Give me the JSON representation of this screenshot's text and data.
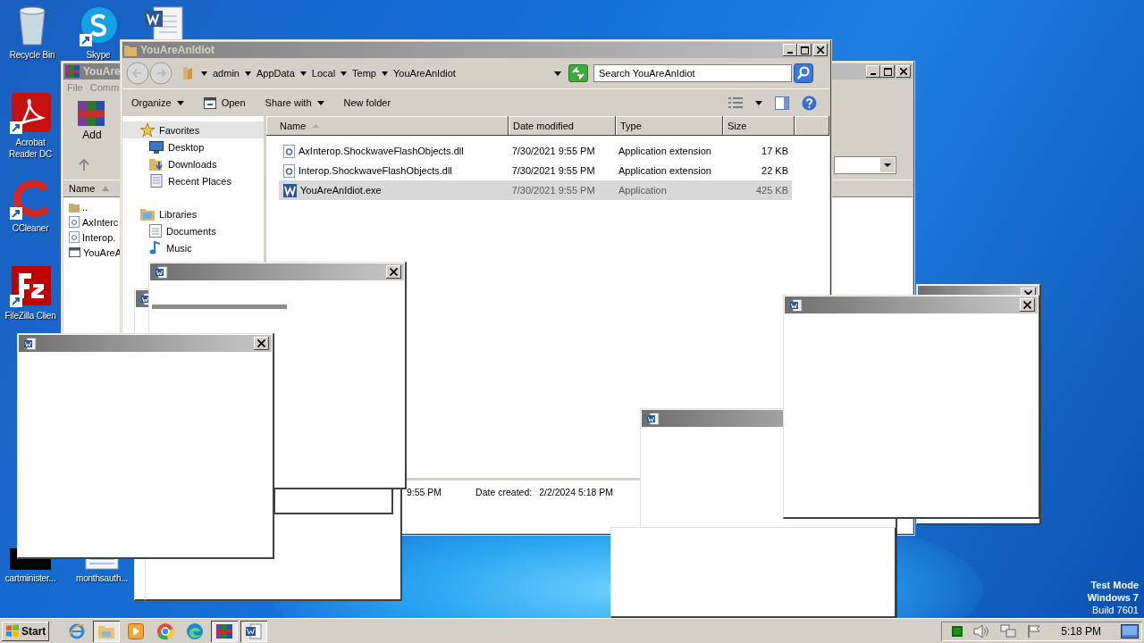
{
  "desktop_icons": [
    {
      "label": "Recycle Bin",
      "kind": "recycle"
    },
    {
      "label": "Skype",
      "kind": "skype"
    },
    {
      "kind": "word"
    },
    {
      "label": "Acrobat Reader DC",
      "kind": "acrobat"
    },
    {
      "label": "CCleaner",
      "kind": "ccleaner"
    },
    {
      "label": "FileZilla Clien",
      "kind": "filezilla"
    },
    {
      "label": "cartminister...",
      "kind": "black"
    },
    {
      "label": "monthsauth...",
      "kind": "document"
    }
  ],
  "winrar": {
    "title": "YouAre",
    "menu": [
      "File",
      "Comm"
    ],
    "add": "Add",
    "column": "Name",
    "files": [
      {
        "name": "..",
        "kind": "folder"
      },
      {
        "name": "AxInterc",
        "kind": "dll"
      },
      {
        "name": "Interop.",
        "kind": "dll"
      },
      {
        "name": "YouAreA",
        "kind": "exe"
      }
    ]
  },
  "explorer": {
    "title": "YouAreAnIdiot",
    "breadcrumb": [
      "admin",
      "AppData",
      "Local",
      "Temp",
      "YouAreAnIdiot"
    ],
    "search": {
      "placeholder": "Search YouAreAnIdiot"
    },
    "toolbar": [
      {
        "label": "Organize",
        "kind": "menu"
      },
      {
        "label": "Open",
        "kind": "open"
      },
      {
        "label": "Share with",
        "kind": "menu"
      },
      {
        "label": "New folder",
        "kind": "plain"
      }
    ],
    "nav": [
      {
        "label": "Favorites",
        "kind": "star",
        "selected": true,
        "children": [
          {
            "label": "Desktop",
            "kind": "desktop",
            "selected": false
          },
          {
            "label": "Downloads",
            "kind": "downloads",
            "selected": false
          },
          {
            "label": "Recent Places",
            "kind": "recent",
            "selected": false
          }
        ]
      },
      {
        "label": "Libraries",
        "kind": "library",
        "selected": false,
        "children": [
          {
            "label": "Documents",
            "kind": "documents",
            "selected": false
          },
          {
            "label": "Music",
            "kind": "music",
            "selected": false
          }
        ]
      }
    ],
    "columns": [
      "Name",
      "Date modified",
      "Type",
      "Size"
    ],
    "rows": [
      {
        "name": "AxInterop.ShockwaveFlashObjects.dll",
        "date": "7/30/2021 9:55 PM",
        "type": "Application extension",
        "size": "17 KB",
        "kind": "dll",
        "selected": false
      },
      {
        "name": "Interop.ShockwaveFlashObjects.dll",
        "date": "7/30/2021 9:55 PM",
        "type": "Application extension",
        "size": "22 KB",
        "kind": "dll",
        "selected": false
      },
      {
        "name": "YouAreAnIdiot.exe",
        "date": "7/30/2021 9:55 PM",
        "type": "Application",
        "size": "425 KB",
        "kind": "exe",
        "selected": true
      }
    ],
    "details": {
      "modified": "9:55 PM",
      "created_label": "Date created:",
      "created": "2/2/2024 5:18 PM"
    }
  },
  "popups": [
    {
      "kind": "plain"
    },
    {
      "kind": "plain"
    },
    {
      "kind": "plain"
    },
    {
      "kind": "plain"
    },
    {
      "kind": "frame"
    },
    {
      "kind": "frame"
    },
    {
      "kind": "progress",
      "level": 0.54
    },
    {
      "kind": "plain"
    }
  ],
  "watermark": [
    "Test Mode",
    "Windows 7",
    "Build 7601"
  ],
  "taskbar": {
    "start": "Start",
    "apps": [
      {
        "kind": "ie",
        "selected": false
      },
      {
        "kind": "explorer",
        "selected": true
      },
      {
        "kind": "media",
        "selected": false
      },
      {
        "kind": "chrome",
        "selected": false
      },
      {
        "kind": "edge",
        "selected": false
      },
      {
        "kind": "winrar",
        "selected": true
      },
      {
        "kind": "word",
        "selected": true
      }
    ],
    "clock": "5:18 PM"
  }
}
